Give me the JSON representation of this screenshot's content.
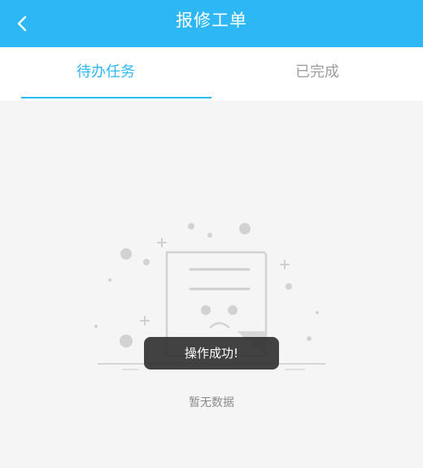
{
  "header": {
    "title": "报修工单",
    "back_icon": "chevron-left-icon",
    "background_color": "#2db7f5"
  },
  "tabs": [
    {
      "label": "待办任务",
      "active": true
    },
    {
      "label": "已完成",
      "active": false
    }
  ],
  "accent_color": "#2db7f5",
  "empty_state": {
    "illustration_icon": "empty-document-icon",
    "message": "暂无数据"
  },
  "toast": {
    "message": "操作成功!"
  }
}
